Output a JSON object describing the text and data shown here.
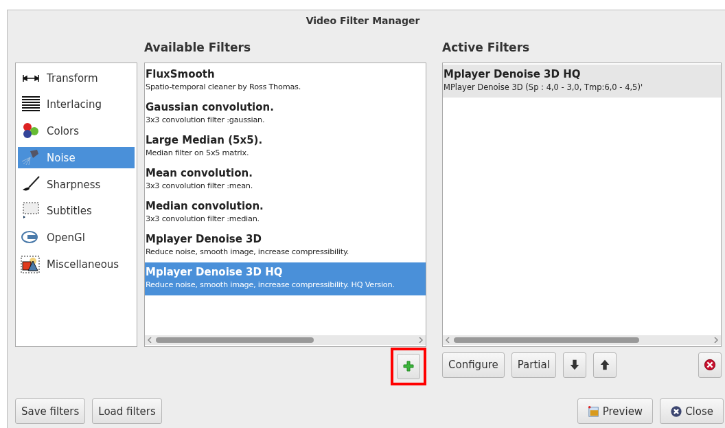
{
  "window": {
    "title": "Video Filter Manager"
  },
  "categories": [
    {
      "label": "Transform",
      "selected": false
    },
    {
      "label": "Interlacing",
      "selected": false
    },
    {
      "label": "Colors",
      "selected": false
    },
    {
      "label": "Noise",
      "selected": true
    },
    {
      "label": "Sharpness",
      "selected": false
    },
    {
      "label": "Subtitles",
      "selected": false
    },
    {
      "label": "OpenGl",
      "selected": false
    },
    {
      "label": "Miscellaneous",
      "selected": false
    }
  ],
  "available_filters": {
    "heading": "Available Filters",
    "items": [
      {
        "name": "FluxSmooth",
        "description": "Spatio-temporal cleaner by Ross Thomas.",
        "selected": false
      },
      {
        "name": "Gaussian convolution.",
        "description": "3x3 convolution filter :gaussian.",
        "selected": false
      },
      {
        "name": "Large Median (5x5).",
        "description": "Median filter on 5x5 matrix.",
        "selected": false
      },
      {
        "name": "Mean convolution.",
        "description": "3x3 convolution filter :mean.",
        "selected": false
      },
      {
        "name": "Median convolution.",
        "description": "3x3 convolution filter :median.",
        "selected": false
      },
      {
        "name": "Mplayer Denoise 3D",
        "description": "Reduce noise, smooth image, increase compressibility.",
        "selected": false
      },
      {
        "name": "Mplayer Denoise 3D HQ",
        "description": "Reduce noise, smooth image, increase compressibility. HQ Version.",
        "selected": true
      }
    ]
  },
  "active_filters": {
    "heading": "Active Filters",
    "items": [
      {
        "name": "Mplayer Denoise 3D HQ",
        "description": "MPlayer Denoise 3D (Sp : 4,0 - 3,0, Tmp:6,0 - 4,5)'",
        "selected": true
      }
    ]
  },
  "add_button": {
    "highlighted": true
  },
  "active_buttons": [
    "Configure",
    "Partial"
  ],
  "bottom_left_buttons": [
    "Save filters",
    "Load filters"
  ],
  "bottom_right_buttons": [
    "Preview",
    "Close"
  ]
}
